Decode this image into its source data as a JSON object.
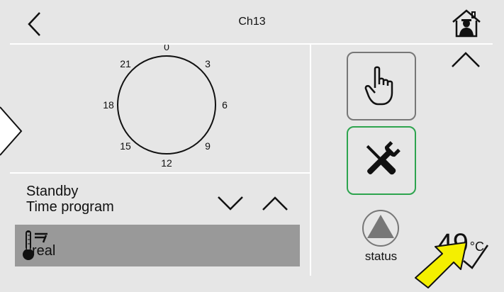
{
  "header": {
    "title": "Ch13",
    "back_icon": "chevron-left-icon",
    "home_icon": "house-person-icon"
  },
  "clock": {
    "labels": [
      {
        "text": "0",
        "hour": 0
      },
      {
        "text": "3",
        "hour": 3
      },
      {
        "text": "6",
        "hour": 6
      },
      {
        "text": "9",
        "hour": 9
      },
      {
        "text": "12",
        "hour": 12
      },
      {
        "text": "15",
        "hour": 15
      },
      {
        "text": "18",
        "hour": 18
      },
      {
        "text": "21",
        "hour": 21
      }
    ]
  },
  "mode": {
    "line1": "Standby",
    "line2": "Time program"
  },
  "temperature": {
    "value": "49",
    "unit": "°C",
    "label": "real"
  },
  "right_panel": {
    "status_label": "status",
    "hand_icon": "hand-pointer-icon",
    "tools_icon": "wrench-screwdriver-icon",
    "status_icon": "triangle-circle-icon"
  },
  "colors": {
    "background": "#e6e6e6",
    "separator": "#ffffff",
    "active_border": "#2da44e",
    "inactive_border": "#777777",
    "temp_bar": "#999999",
    "arrow": "#f4ef00"
  }
}
